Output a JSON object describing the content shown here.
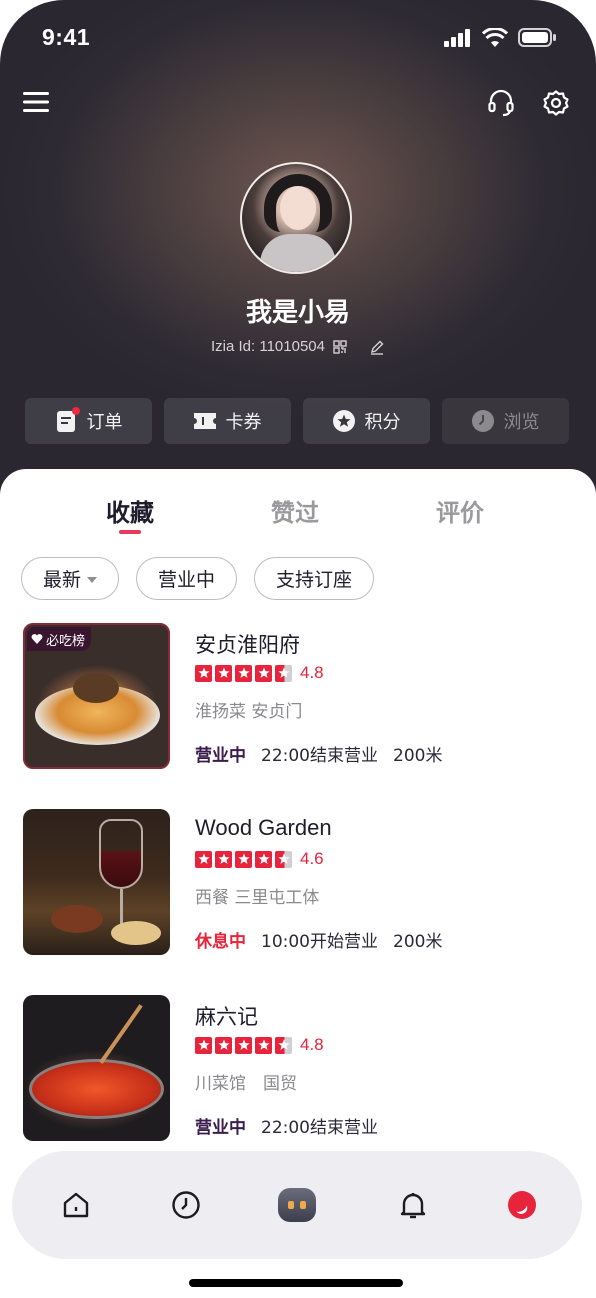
{
  "status_bar": {
    "time": "9:41"
  },
  "profile": {
    "name": "我是小易",
    "id_label": "Izia Id: 11010504"
  },
  "quick_actions": [
    {
      "label": "订单",
      "icon": "order-icon",
      "has_dot": true
    },
    {
      "label": "卡券",
      "icon": "ticket-icon"
    },
    {
      "label": "积分",
      "icon": "star-badge-icon"
    },
    {
      "label": "浏览",
      "icon": "clock-icon",
      "dimmed": true
    }
  ],
  "tabs": [
    {
      "label": "收藏",
      "active": true
    },
    {
      "label": "赞过",
      "active": false
    },
    {
      "label": "评价",
      "active": false
    }
  ],
  "filters": [
    {
      "label": "最新",
      "dropdown": true
    },
    {
      "label": "营业中"
    },
    {
      "label": "支持订座"
    }
  ],
  "restaurants": [
    {
      "name": "安贞淮阳府",
      "badge": "必吃榜",
      "rating": "4.8",
      "tags": "淮扬菜 安贞门",
      "status": "营业中",
      "hours": "22:00结束营业",
      "distance": "200米"
    },
    {
      "name": "Wood Garden",
      "rating": "4.6",
      "tags": "西餐 三里屯工体",
      "status": "休息中",
      "hours": "10:00开始营业",
      "distance": "200米"
    },
    {
      "name": "麻六记",
      "rating": "4.8",
      "tags": "川菜馆　国贸",
      "status": "营业中",
      "hours": "22:00结束营业"
    }
  ],
  "colors": {
    "accent": "#e8243c",
    "open_status": "#3b1d4d",
    "header_bg": "#2f2b34"
  },
  "bottom_nav": [
    "home-icon",
    "clock-icon",
    "robot-icon",
    "bell-icon",
    "profile-icon"
  ]
}
